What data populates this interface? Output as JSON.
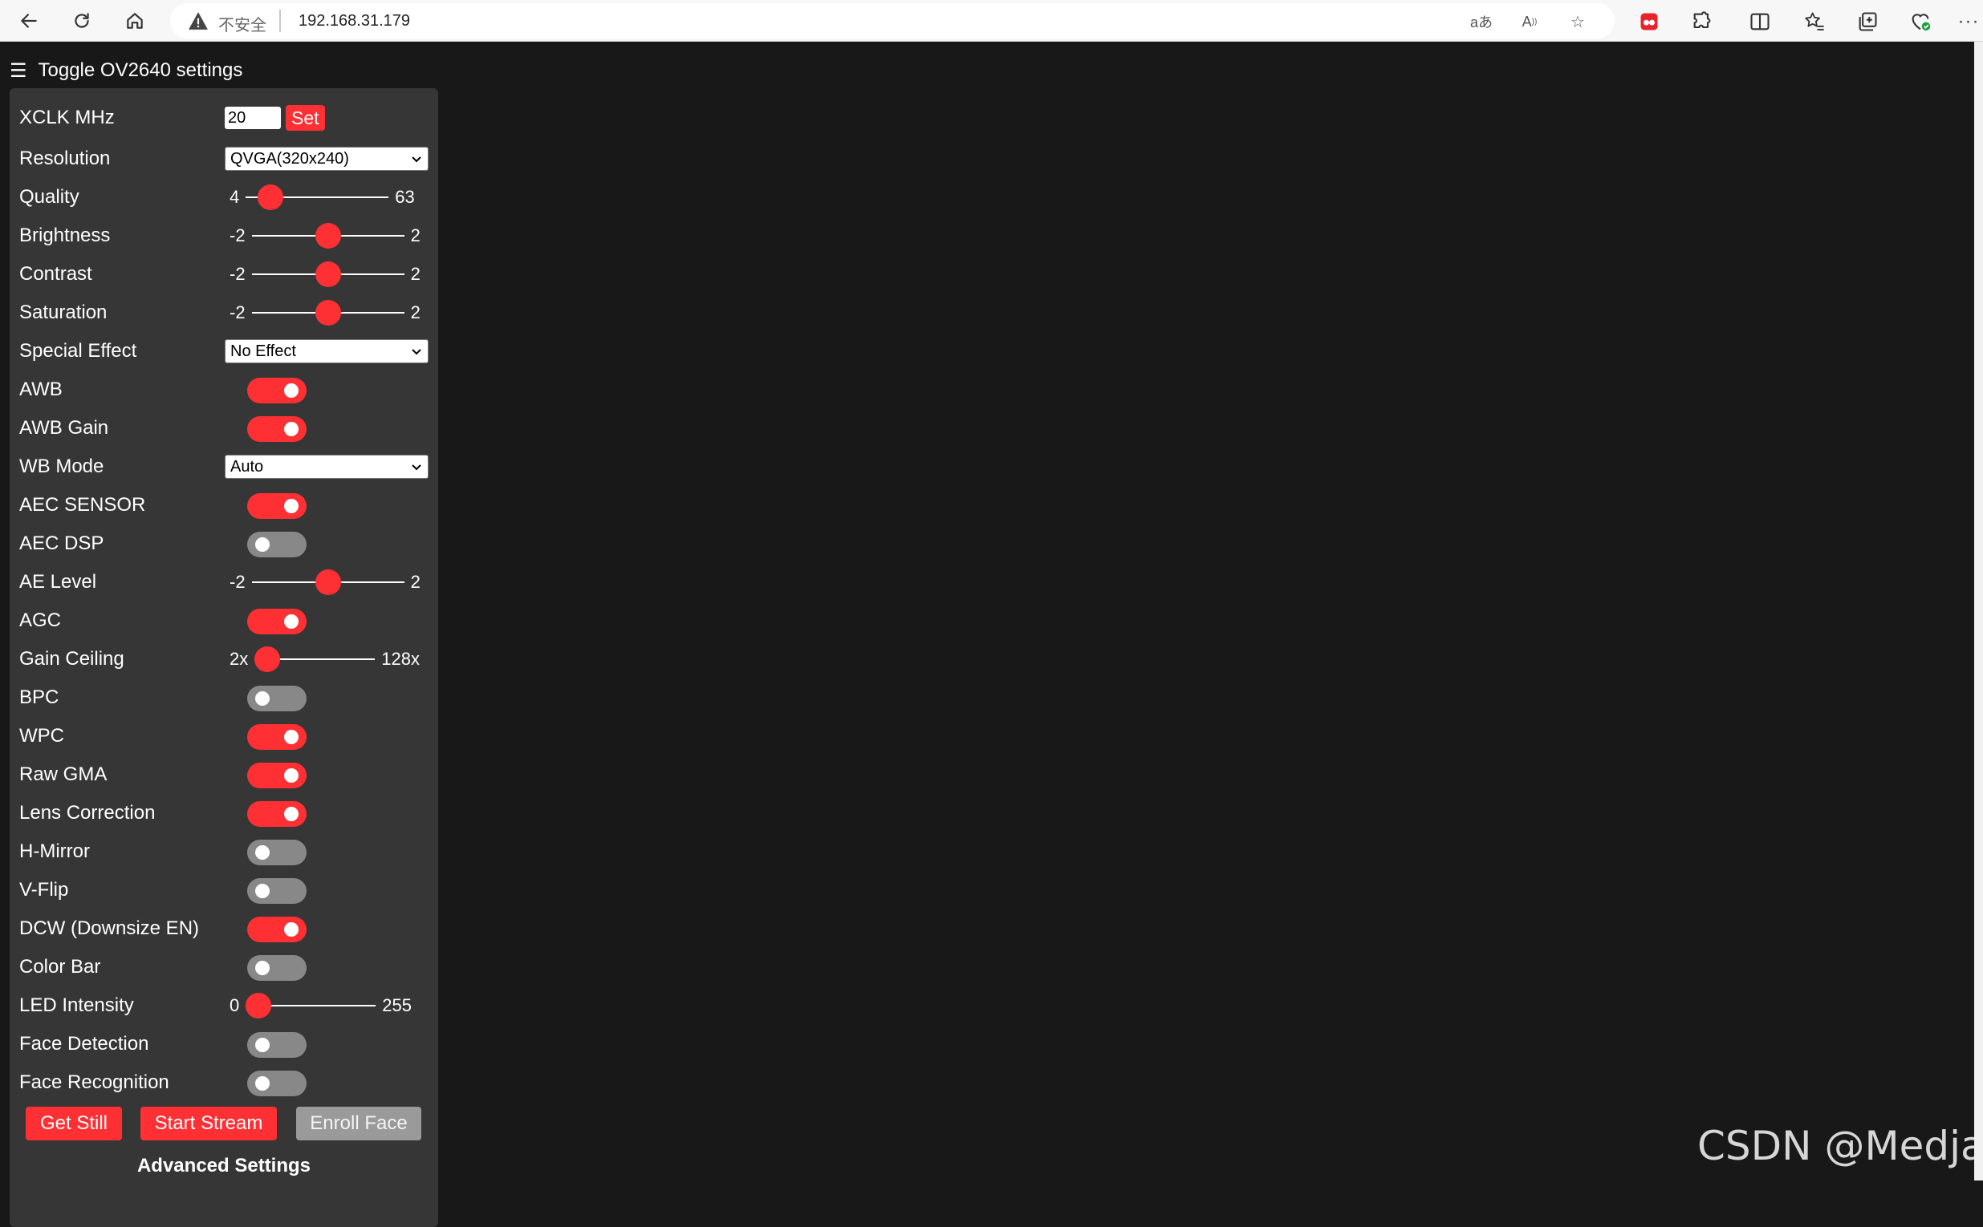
{
  "browser": {
    "insecure_label": "不安全",
    "url": "192.168.31.179"
  },
  "panel": {
    "toggle_label": "Toggle OV2640 settings",
    "hamburger": "☰",
    "xclk": {
      "label": "XCLK MHz",
      "value": "20",
      "set_label": "Set"
    },
    "resolution": {
      "label": "Resolution",
      "selected": "QVGA(320x240)"
    },
    "quality": {
      "label": "Quality",
      "min": "4",
      "max": "63",
      "value": 10,
      "lo": 4,
      "hi": 63
    },
    "brightness": {
      "label": "Brightness",
      "min": "-2",
      "max": "2",
      "value": 0,
      "lo": -2,
      "hi": 2
    },
    "contrast": {
      "label": "Contrast",
      "min": "-2",
      "max": "2",
      "value": 0,
      "lo": -2,
      "hi": 2
    },
    "saturation": {
      "label": "Saturation",
      "min": "-2",
      "max": "2",
      "value": 0,
      "lo": -2,
      "hi": 2
    },
    "special_effect": {
      "label": "Special Effect",
      "selected": "No Effect"
    },
    "awb": {
      "label": "AWB",
      "on": true
    },
    "awb_gain": {
      "label": "AWB Gain",
      "on": true
    },
    "wb_mode": {
      "label": "WB Mode",
      "selected": "Auto"
    },
    "aec_sensor": {
      "label": "AEC SENSOR",
      "on": true
    },
    "aec_dsp": {
      "label": "AEC DSP",
      "on": false
    },
    "ae_level": {
      "label": "AE Level",
      "min": "-2",
      "max": "2",
      "value": 0,
      "lo": -2,
      "hi": 2
    },
    "agc": {
      "label": "AGC",
      "on": true
    },
    "gain_ceiling": {
      "label": "Gain Ceiling",
      "min": "2x",
      "max": "128x",
      "value": 0,
      "lo": 0,
      "hi": 6
    },
    "bpc": {
      "label": "BPC",
      "on": false
    },
    "wpc": {
      "label": "WPC",
      "on": true
    },
    "raw_gma": {
      "label": "Raw GMA",
      "on": true
    },
    "lens_correction": {
      "label": "Lens Correction",
      "on": true
    },
    "h_mirror": {
      "label": "H-Mirror",
      "on": false
    },
    "v_flip": {
      "label": "V-Flip",
      "on": false
    },
    "dcw": {
      "label": "DCW (Downsize EN)",
      "on": true
    },
    "color_bar": {
      "label": "Color Bar",
      "on": false
    },
    "led_intensity": {
      "label": "LED Intensity",
      "min": "0",
      "max": "255",
      "value": 0,
      "lo": 0,
      "hi": 255
    },
    "face_detection": {
      "label": "Face Detection",
      "on": false
    },
    "face_recognition": {
      "label": "Face Recognition",
      "on": false
    },
    "get_still": "Get Still",
    "start_stream": "Start Stream",
    "enroll_face": "Enroll Face",
    "advanced": "Advanced Settings"
  },
  "watermark": "CSDN @Medjay_",
  "colors": {
    "accent": "#ff3034",
    "panel_bg": "#363636",
    "page_bg": "#181818",
    "switch_off": "#888888"
  }
}
